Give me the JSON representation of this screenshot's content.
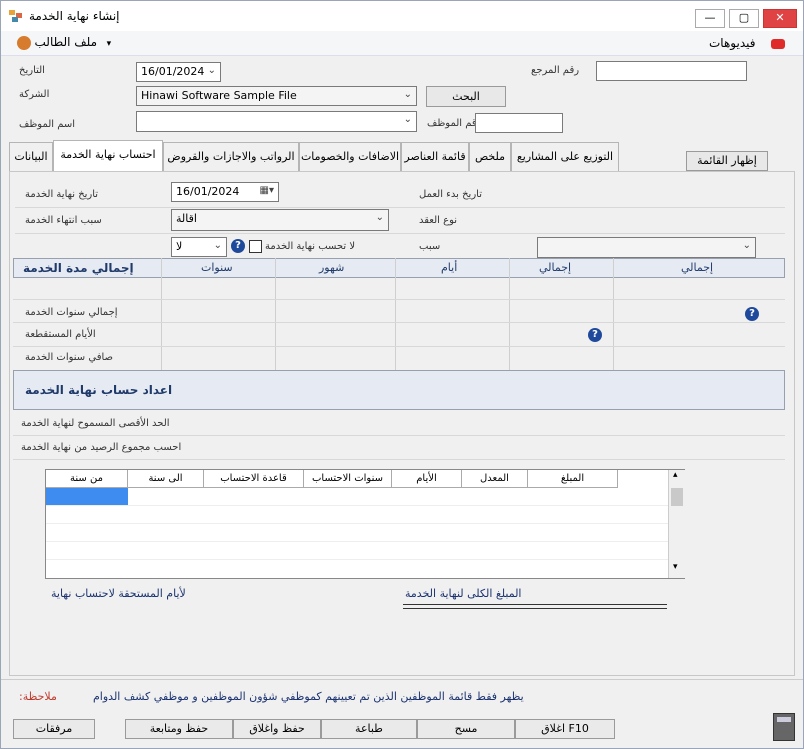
{
  "window": {
    "title": "إنشاء نهاية الخدمة"
  },
  "menu": {
    "student_file": "ملف الطالب",
    "videos": "فيديوهات"
  },
  "header": {
    "date_label": "التاريخ",
    "date_value": "16/01/2024",
    "company_label": "الشركة",
    "company_value": "Hinawi Software Sample File",
    "employee_name_label": "اسم الموظف",
    "reference_label": "رقم المرجع",
    "employee_no_label": "رقم الموظف",
    "search_button": "البحث"
  },
  "tabs": [
    {
      "label": "البيانات"
    },
    {
      "label": "احتساب نهاية الخدمة"
    },
    {
      "label": "الرواتب والاجازات والقروض"
    },
    {
      "label": "الاضافات والخصومات"
    },
    {
      "label": "قائمة العناصر"
    },
    {
      "label": "ملخص"
    },
    {
      "label": "التوزيع على المشاريع"
    }
  ],
  "show_list_button": "إظهار القائمة",
  "form": {
    "end_date_label": "تاريخ نهاية الخدمة",
    "end_date_value": "16/01/2024",
    "end_reason_label": "سبب انتهاء الخدمة",
    "end_reason_value": "اقالة",
    "start_date_label": "تاريخ بدء العمل",
    "contract_type_label": "نوع العقد",
    "no_calc_label": "لا تحسب نهاية الخدمة",
    "no_value": "لا",
    "reason_label": "سبب"
  },
  "service_table": {
    "title": "إجمالي مدة الخدمة",
    "col_years": "سنوات",
    "col_months": "شهور",
    "col_days": "أيام",
    "col_total1": "إجمالي",
    "col_total2": "إجمالي",
    "row1": "إجمالي سنوات الخدمة",
    "row2": "الأيام المستقطعة",
    "row3": "صافي سنوات الخدمة"
  },
  "settings": {
    "title": "اعداد حساب نهاية الخدمة",
    "max_label": "الحد الأقصى المسموح لنهاية الخدمة",
    "balance_label": "احسب مجموع الرصيد من نهاية الخدمة"
  },
  "grid": {
    "headers": [
      "من سنة",
      "الى سنة",
      "قاعدة الاحتساب",
      "سنوات الاحتساب",
      "الأيام",
      "المعدل",
      "المبلغ"
    ]
  },
  "totals": {
    "days_due_label": "لأيام المستحقة لاحتساب نهاية",
    "total_amount_label": "المبلغ الكلى لنهاية الخدمة"
  },
  "note": {
    "label": "ملاحظة:",
    "text": "يظهر فقط قائمة الموظفين الذين تم تعيينهم كموظفي شؤون الموظفين و موظفي كشف الدوام"
  },
  "buttons": {
    "attachments": "مرفقات",
    "save_continue": "حفظ ومتابعة",
    "save_close": "حفظ واغلاق",
    "print": "طباعة",
    "clear": "مسح",
    "close": "F10 اغلاق"
  }
}
